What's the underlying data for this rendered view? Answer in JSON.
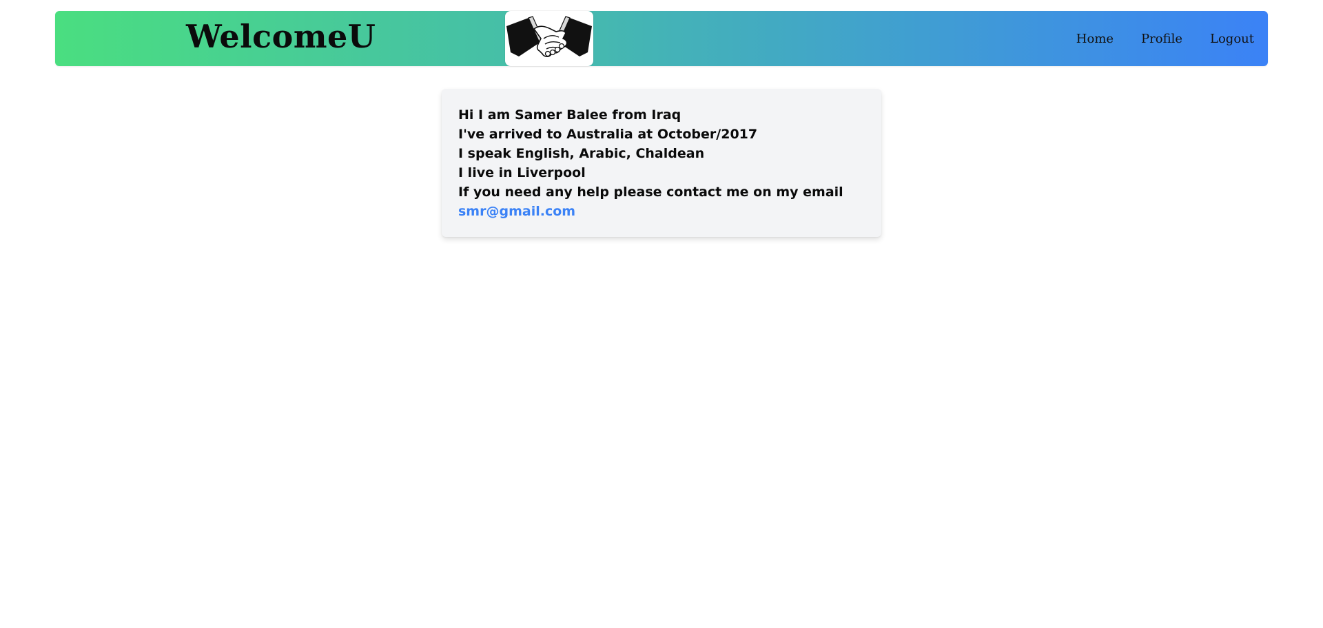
{
  "header": {
    "brand": "WelcomeU",
    "logo_icon": "handshake-icon",
    "nav": [
      {
        "label": "Home"
      },
      {
        "label": "Profile"
      },
      {
        "label": "Logout"
      }
    ]
  },
  "profile_card": {
    "lines": [
      "Hi I am Samer Balee from Iraq",
      "I've arrived to Australia at October/2017",
      "I speak English, Arabic, Chaldean",
      "I live in Liverpool",
      "If you need any help please contact me on my email"
    ],
    "email": "smr@gmail.com"
  },
  "colors": {
    "gradient_start": "#4ade80",
    "gradient_end": "#3b82f6",
    "card_background": "#f3f4f6",
    "link": "#3b82f6"
  }
}
